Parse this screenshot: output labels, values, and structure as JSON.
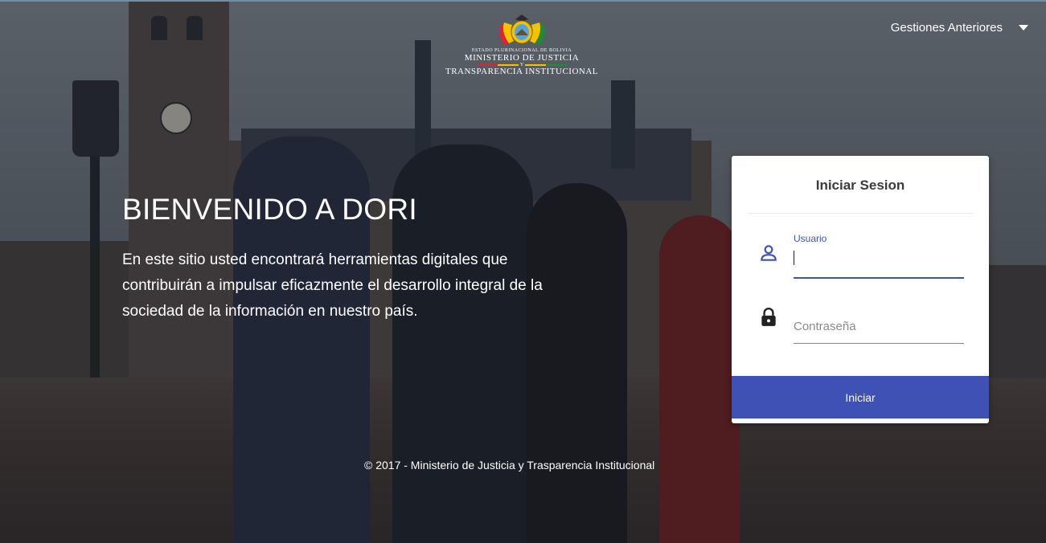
{
  "header": {
    "logo": {
      "line1": "ESTADO PLURINACIONAL DE BOLIVIA",
      "line2": "MINISTERIO DE JUSTICIA",
      "connector": "Y",
      "line3": "TRANSPARENCIA INSTITUCIONAL"
    },
    "menu_label": "Gestiones Anteriores"
  },
  "hero": {
    "title": "BIENVENIDO A DORI",
    "description": "En este sitio usted encontrará herramientas digitales que contribuirán a impulsar eficazmente el desarrollo integral de la sociedad de la información en nuestro país."
  },
  "login": {
    "title": "Iniciar Sesion",
    "username": {
      "label": "Usuario",
      "value": ""
    },
    "password": {
      "placeholder": "Contraseña",
      "value": ""
    },
    "submit_label": "Iniciar"
  },
  "footer": {
    "text": "© 2017 - Ministerio de Justicia y Trasparencia Institucional"
  },
  "colors": {
    "accent": "#3f51b5",
    "overlay": "#14181e",
    "card_background": "#ffffff"
  },
  "icons": {
    "username": "person-icon",
    "password": "lock-icon",
    "menu": "caret-down-icon"
  }
}
